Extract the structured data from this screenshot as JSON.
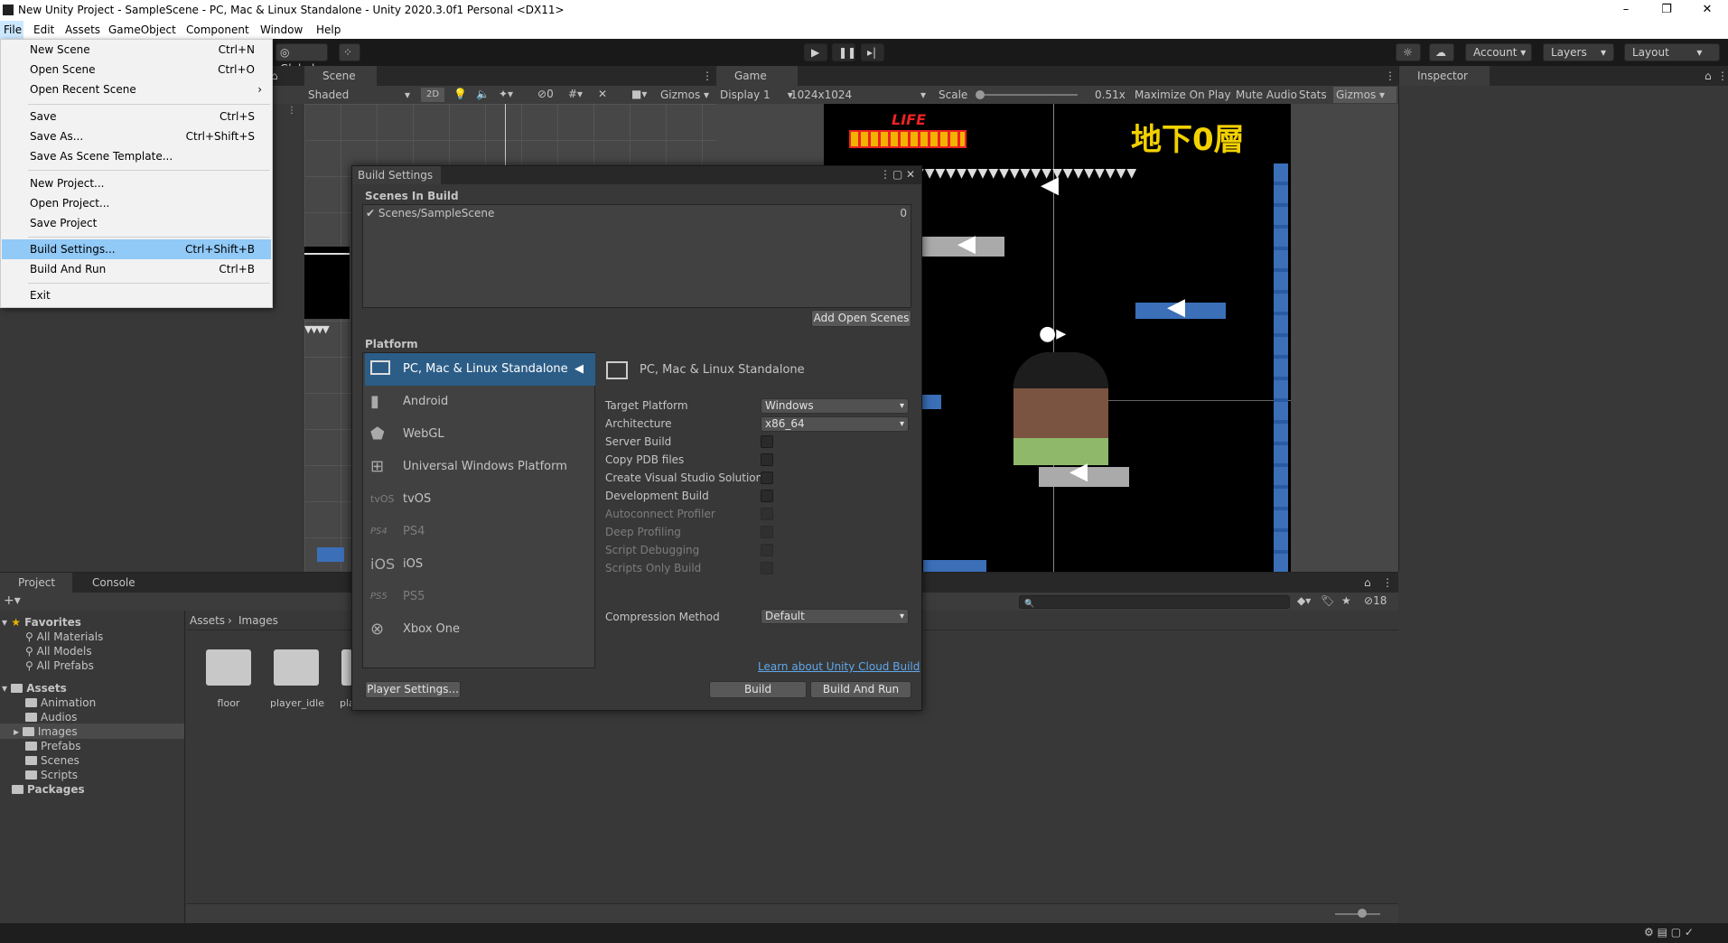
{
  "window": {
    "title": "New Unity Project - SampleScene - PC, Mac & Linux Standalone - Unity 2020.3.0f1 Personal <DX11>"
  },
  "menubar": {
    "items": [
      "File",
      "Edit",
      "Assets",
      "GameObject",
      "Component",
      "Window",
      "Help"
    ]
  },
  "toolbar": {
    "global": "Global",
    "account": "Account",
    "layers": "Layers",
    "layout": "Layout"
  },
  "file_menu": {
    "items": [
      {
        "label": "New Scene",
        "shortcut": "Ctrl+N"
      },
      {
        "label": "Open Scene",
        "shortcut": "Ctrl+O"
      },
      {
        "label": "Open Recent Scene",
        "shortcut": "›"
      },
      {
        "label": "Save",
        "shortcut": "Ctrl+S"
      },
      {
        "label": "Save As...",
        "shortcut": "Ctrl+Shift+S"
      },
      {
        "label": "Save As Scene Template...",
        "shortcut": ""
      },
      {
        "label": "New Project...",
        "shortcut": ""
      },
      {
        "label": "Open Project...",
        "shortcut": ""
      },
      {
        "label": "Save Project",
        "shortcut": ""
      },
      {
        "label": "Build Settings...",
        "shortcut": "Ctrl+Shift+B"
      },
      {
        "label": "Build And Run",
        "shortcut": "Ctrl+B"
      },
      {
        "label": "Exit",
        "shortcut": ""
      }
    ]
  },
  "scene": {
    "tab": "Scene",
    "shading": "Shaded",
    "mode2d": "2D",
    "hidden_count": "0",
    "gizmos": "Gizmos"
  },
  "game": {
    "tab": "Game",
    "display": "Display 1",
    "resolution": "1024x1024",
    "scale_label": "Scale",
    "scale_value": "0.51x",
    "maximize": "Maximize On Play",
    "mute": "Mute Audio",
    "stats": "Stats",
    "gizmos": "Gizmos",
    "life": "LIFE",
    "floor_title": "地下0層"
  },
  "inspector": {
    "tab": "Inspector"
  },
  "build_settings": {
    "title": "Build Settings",
    "scenes_header": "Scenes In Build",
    "scene_name": "Scenes/SampleScene",
    "scene_index": "0",
    "add_open_scenes": "Add Open Scenes",
    "platform_header": "Platform",
    "platforms": [
      {
        "name": "PC, Mac & Linux Standalone",
        "icon": "monitor-icon"
      },
      {
        "name": "Android",
        "icon": "android-icon"
      },
      {
        "name": "WebGL",
        "icon": "html5-icon"
      },
      {
        "name": "Universal Windows Platform",
        "icon": "windows-icon"
      },
      {
        "name": "tvOS",
        "icon": "tvos-icon"
      },
      {
        "name": "PS4",
        "icon": "ps4-icon"
      },
      {
        "name": "iOS",
        "icon": "ios-icon"
      },
      {
        "name": "PS5",
        "icon": "ps5-icon"
      },
      {
        "name": "Xbox One",
        "icon": "xbox-icon"
      }
    ],
    "selected_platform": "PC, Mac & Linux Standalone",
    "options": {
      "target_platform": {
        "label": "Target Platform",
        "value": "Windows"
      },
      "architecture": {
        "label": "Architecture",
        "value": "x86_64"
      },
      "server_build": "Server Build",
      "copy_pdb": "Copy PDB files",
      "create_vs": "Create Visual Studio Solution",
      "dev_build": "Development Build",
      "autoconnect": "Autoconnect Profiler",
      "deep_profiling": "Deep Profiling",
      "script_debugging": "Script Debugging",
      "scripts_only": "Scripts Only Build",
      "compression": {
        "label": "Compression Method",
        "value": "Default"
      }
    },
    "cloud_link": "Learn about Unity Cloud Build",
    "player_settings": "Player Settings...",
    "build": "Build",
    "build_and_run": "Build And Run"
  },
  "project": {
    "tab_project": "Project",
    "tab_console": "Console",
    "favorites": "Favorites",
    "favorite_items": [
      "All Materials",
      "All Models",
      "All Prefabs"
    ],
    "assets": "Assets",
    "asset_folders": [
      "Animation",
      "Audios",
      "Images",
      "Prefabs",
      "Scenes",
      "Scripts"
    ],
    "packages": "Packages",
    "breadcrumb": [
      "Assets",
      "Images"
    ],
    "grid_items": [
      "floor",
      "player_idle",
      "pla"
    ],
    "hidden_count": "18"
  }
}
